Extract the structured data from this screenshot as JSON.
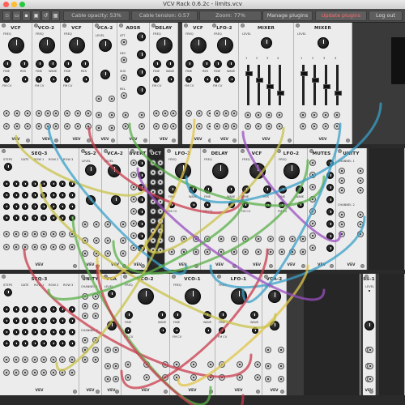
{
  "window": {
    "title": "VCV Rack 0.6.2c - limits.vcv"
  },
  "toolbar": {
    "cable_opacity": "Cable opacity: 53%",
    "cable_tension": "Cable tension: 0.57",
    "zoom": "Zoom: 77%",
    "manage_plugins": "Manage plugins",
    "update_plugins": "Update plugins",
    "log_out": "Log out"
  },
  "brand": "VEV",
  "rows": [
    {
      "modules": [
        "VCF",
        "VCO-2",
        "VCF",
        "VCA-2",
        "ADSR",
        "DELAY",
        "VCF",
        "LFO-2",
        "MIXER",
        "MIXER"
      ]
    },
    {
      "modules": [
        "SEQ-3",
        "SS-2",
        "VCA-2",
        "8VERT",
        "OCT",
        "LFO-2",
        "DELAY",
        "VCF",
        "LFO-2",
        "MUTES",
        "UNITY"
      ]
    },
    {
      "modules": [
        "SEQ-3",
        "UNITY",
        "VCA",
        "VCO-2",
        "VCO-1",
        "LFO-1",
        "VCA-2",
        "SS-1"
      ]
    }
  ],
  "labels": {
    "freq": "FREQ",
    "fine": "FINE",
    "res": "RES",
    "wave": "WAVE",
    "drive": "DRIVE",
    "fm_cv": "FM CV",
    "freq_cv": "FREQ CV",
    "level": "LEVEL",
    "gate": "GATE",
    "steps": "STEPS",
    "row1": "ROW 1",
    "row2": "ROW 2",
    "row3": "ROW 3",
    "time": "TIME",
    "feedback": "FEEDBK",
    "color": "COLOR",
    "mix": "MIX",
    "att": "ATT",
    "dec": "DEC",
    "sus": "SUS",
    "rel": "REL",
    "ch1": "CHANNEL 1",
    "ch2": "CHANNEL 2",
    "pwidth": "P WIDTH",
    "pwm_cv": "PWM CV",
    "reset": "RESET",
    "saw": "SAW",
    "sqr": "SQR",
    "sin": "SIN",
    "tri": "TRI"
  },
  "mixer_channels": [
    "1",
    "2",
    "3",
    "4"
  ]
}
